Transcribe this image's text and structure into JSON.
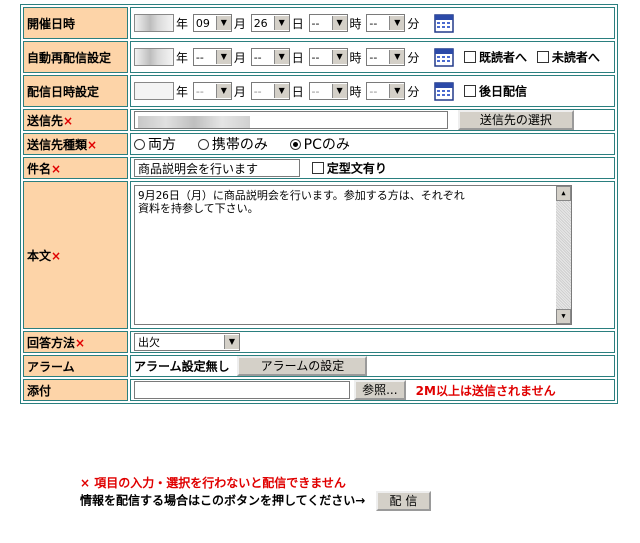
{
  "rows": {
    "date": {
      "label": "開催日時",
      "year_unit": "年",
      "month_value": "09",
      "month_unit": "月",
      "day_value": "26",
      "day_unit": "日",
      "hour_value": "--",
      "hour_unit": "時",
      "minute_value": "--",
      "minute_unit": "分"
    },
    "auto_resend": {
      "label": "自動再配信設定",
      "year_unit": "年",
      "month_value": "--",
      "month_unit": "月",
      "day_value": "--",
      "day_unit": "日",
      "hour_value": "--",
      "hour_unit": "時",
      "minute_value": "--",
      "minute_unit": "分",
      "check_read_label": "既読者へ",
      "check_unread_label": "未読者へ"
    },
    "delivery": {
      "label": "配信日時設定",
      "year_unit": "年",
      "month_value": "--",
      "month_unit": "月",
      "day_value": "--",
      "day_unit": "日",
      "hour_value": "--",
      "hour_unit": "時",
      "minute_value": "--",
      "minute_unit": "分",
      "later_label": "後日配信"
    },
    "recipient": {
      "label": "送信先",
      "required_mark": "×",
      "select_button": "送信先の選択"
    },
    "recipient_type": {
      "label": "送信先種類",
      "required_mark": "×",
      "options": [
        "両方",
        "携帯のみ",
        "PCのみ"
      ]
    },
    "subject": {
      "label": "件名",
      "required_mark": "×",
      "value": "商品説明会を行います",
      "template_label": "定型文有り"
    },
    "body": {
      "label": "本文",
      "required_mark": "×",
      "value": "9月26日（月）に商品説明会を行います。参加する方は、それぞれ\n資料を持参して下さい。"
    },
    "answer": {
      "label": "回答方法",
      "required_mark": "×",
      "value": "出欠"
    },
    "alarm": {
      "label": "アラーム",
      "status": "アラーム設定無し",
      "button": "アラームの設定"
    },
    "attach": {
      "label": "添付",
      "browse_button": "参照...",
      "note": "2M以上は送信されません"
    }
  },
  "footer": {
    "notice": "× 項目の入力・選択を行わないと配信できません",
    "send_prompt": "情報を配信する場合はこのボタンを押してください→",
    "send_button": "配 信"
  }
}
